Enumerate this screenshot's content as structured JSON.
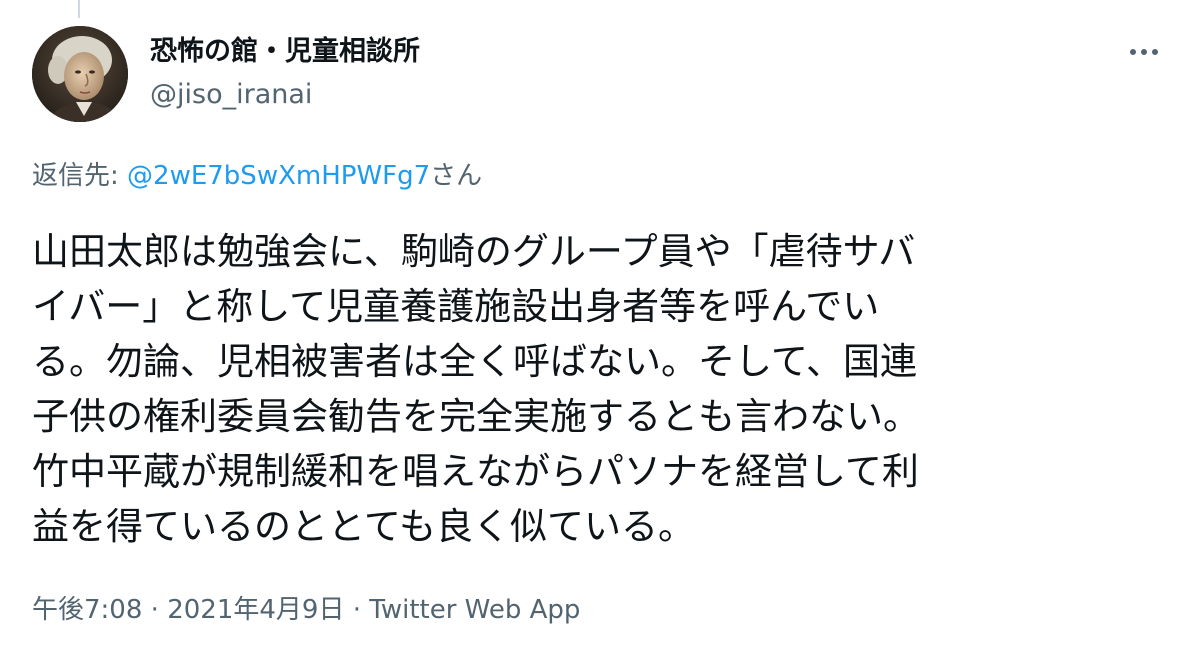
{
  "tweet": {
    "author": {
      "display_name": "恐怖の館・児童相談所",
      "handle": "@jiso_iranai",
      "avatar_icon": "portrait-avatar"
    },
    "more_icon": "more-horizontal-icon",
    "reply": {
      "prefix": "返信先: ",
      "mention": "@2wE7bSwXmHPWFg7",
      "suffix": "さん"
    },
    "text_lines": [
      "山田太郎は勉強会に、駒崎のグループ員や「虐待サバ",
      "イバー」と称して児童養護施設出身者等を呼んでい",
      "る。勿論、児相被害者は全く呼ばない。そして、国連",
      "子供の権利委員会勧告を完全実施するとも言わない。",
      "竹中平蔵が規制緩和を唱えながらパソナを経営して利",
      "益を得ているのととても良く似ている。"
    ],
    "time": "午後7:08",
    "separator": " · ",
    "date": "2021年4月9日",
    "source": "Twitter Web App"
  },
  "colors": {
    "text_primary": "#0f1419",
    "text_secondary": "#536471",
    "link": "#1d9bf0",
    "thread_line": "#cfd9de"
  }
}
